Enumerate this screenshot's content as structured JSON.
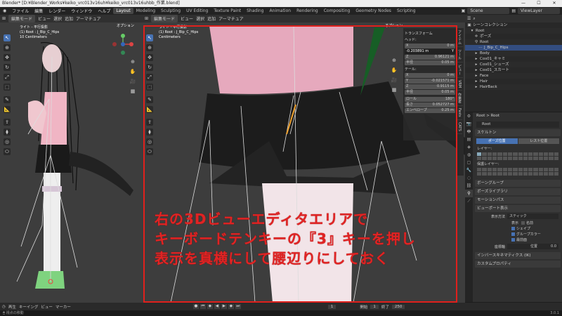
{
  "window": {
    "title": "Blender* [D:¥Blender_Works¥keiko_vrc013v16uh¥keiko_vrc013v16uhbb_作業.blend]",
    "minimize": "—",
    "maximize": "☐",
    "close": "✕"
  },
  "menubar": {
    "items": [
      "ファイル",
      "編集",
      "レンダー",
      "ウィンドウ",
      "ヘルプ"
    ],
    "workspaces": [
      "Layout",
      "Modeling",
      "Sculpting",
      "UV Editing",
      "Texture Paint",
      "Shading",
      "Animation",
      "Rendering",
      "Compositing",
      "Geometry Nodes",
      "Scripting"
    ],
    "active_workspace": "Layout",
    "scene": "Scene",
    "view_layer": "ViewLayer"
  },
  "left_viewport": {
    "mode": "編集モード",
    "menus": [
      "ビュー",
      "選択",
      "追加",
      "アーマチュア"
    ],
    "info": [
      "ライト - 平行投影",
      "(1) Root : J_Bip_C_Hips",
      "10 Centimeters"
    ],
    "options": "オプション"
  },
  "right_viewport": {
    "mode": "編集モード",
    "menus": [
      "ビュー",
      "選択",
      "追加",
      "アーマチュア"
    ],
    "info": [
      "ライト - 平行投影",
      "(1) Root : J_Bip_C_Hips",
      "Centimeters"
    ],
    "options": "オプション"
  },
  "transform_panel": {
    "title": "トランスフォーム",
    "head_label": "ヘッド:",
    "head": [
      {
        "k": "X",
        "v": "0 m"
      },
      {
        "k": "Y",
        "v": "-0.203891 m"
      },
      {
        "k": "Z",
        "v": "0.96121 m"
      }
    ],
    "radius1": {
      "k": "半径",
      "v": "0.05 m"
    },
    "tail_label": "テール:",
    "tail": [
      {
        "k": "X",
        "v": "0 m"
      },
      {
        "k": "Y",
        "v": "-0.021571 m"
      },
      {
        "k": "Z",
        "v": "0.9115 m"
      }
    ],
    "radius2": {
      "k": "半径",
      "v": "0.05 m"
    },
    "roll": {
      "k": "ロール",
      "v": "180°"
    },
    "length": {
      "k": "長さ",
      "v": "0.052727 m"
    },
    "envelope": {
      "k": "エンベロープ",
      "v": "0.25 m"
    }
  },
  "sidebar_tabs": [
    "アイテム",
    "ツール",
    "ビュー",
    "VRM",
    "作業者",
    "Fasts",
    "CATS"
  ],
  "caption": [
    "右の3Dビューエディタエリアで",
    "キーボードテンキーの『3』キーを押し",
    "表示を真横にして腰辺りにしておく"
  ],
  "outliner": {
    "title": "シーンコレクション",
    "items": [
      {
        "indent": 1,
        "icon": "▾",
        "name": "Root"
      },
      {
        "indent": 2,
        "icon": "✛",
        "name": "ポーズ"
      },
      {
        "indent": 2,
        "icon": "⚲",
        "name": "Root"
      },
      {
        "indent": 3,
        "icon": "⋯",
        "name": "J_Bip_C_Hips"
      },
      {
        "indent": 2,
        "icon": "▸",
        "name": "Body"
      },
      {
        "indent": 2,
        "icon": "▸",
        "name": "Cos01_キャミ"
      },
      {
        "indent": 2,
        "icon": "▸",
        "name": "Cos01_シューズ"
      },
      {
        "indent": 2,
        "icon": "▸",
        "name": "Cos01_スカート"
      },
      {
        "indent": 2,
        "icon": "▸",
        "name": "Face"
      },
      {
        "indent": 2,
        "icon": "▸",
        "name": "Hair"
      },
      {
        "indent": 2,
        "icon": "▸",
        "name": "HairBack"
      }
    ]
  },
  "properties": {
    "breadcrumb": "Root  >  Root",
    "name_field": "Root",
    "skeleton": "スケルトン",
    "pose_position": "ポーズ位置",
    "rest_position": "レスト位置",
    "layers": "レイヤー:",
    "protected_layers": "保護レイヤー:",
    "bone_groups": "ボーングループ",
    "pose_library": "ポーズライブラリ",
    "motion_paths": "モーションパス",
    "viewport_display": "ビューポート表示",
    "display_as_label": "表示方法",
    "display_as": "スティック",
    "show_label": "表示",
    "names": "名前",
    "shapes": "シェイプ",
    "group_colors": "グループカラー",
    "in_front": "最前面",
    "axes_label": "座標軸",
    "axes_pos": "位置",
    "axes_val": "0.0",
    "ik": "インバースキネマティクス (IK)",
    "custom_props": "カスタムプロパティ"
  },
  "timeline": {
    "menus": [
      "再生",
      "キーイング",
      "ビュー",
      "マーカー"
    ],
    "current_frame": "1",
    "start_label": "開始",
    "start": "1",
    "end_label": "終了",
    "end": "250"
  },
  "statusbar": {
    "hint": "視点の移動",
    "version": "3.0.1"
  },
  "colors": {
    "accent": "#4772b3",
    "caption": "#e02424",
    "redbox": "#e0201c"
  }
}
